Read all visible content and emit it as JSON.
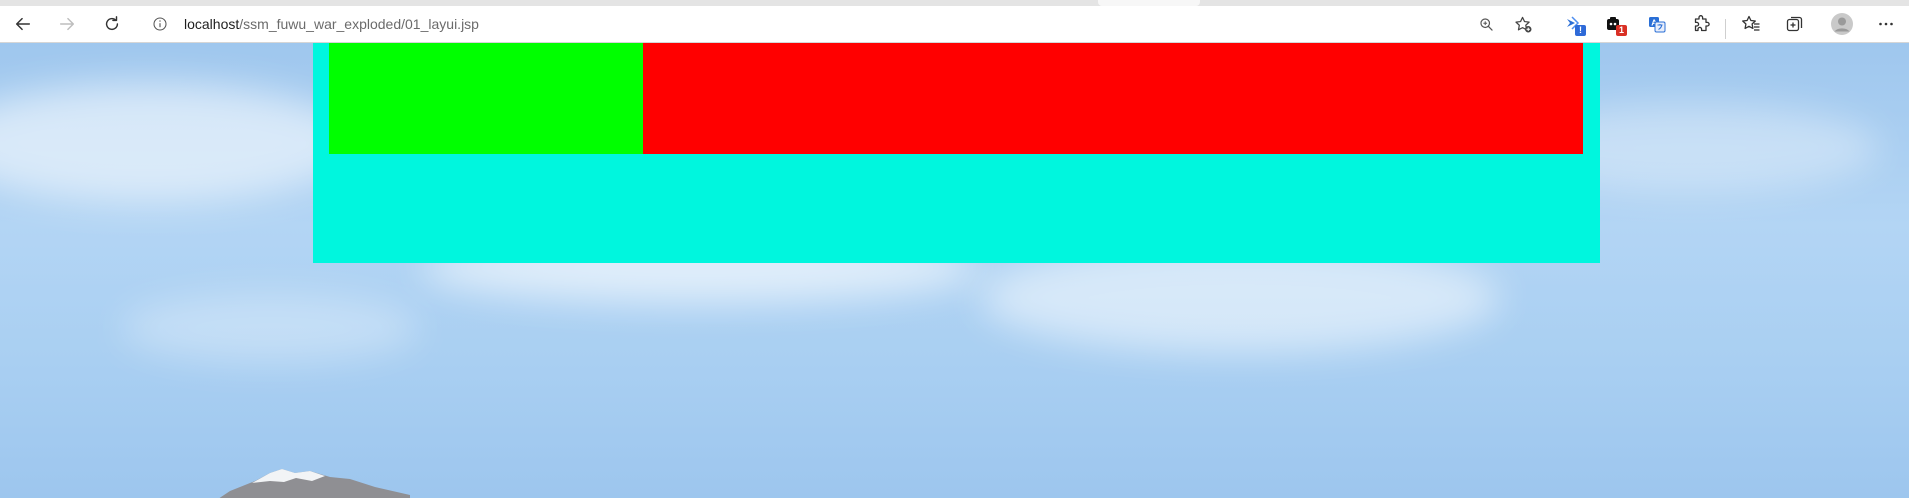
{
  "browser": {
    "address_bar": {
      "host": "localhost",
      "path": "/ssm_fuwu_war_exploded/01_layui.jsp"
    },
    "toolbar_icons": [
      "back-arrow-icon",
      "forward-arrow-icon",
      "refresh-icon",
      "site-info-icon",
      "zoom-icon",
      "add-favorite-icon",
      "extension-1-icon",
      "extension-2-icon",
      "translate-icon",
      "extensions-puzzle-icon",
      "favorites-icon",
      "collections-icon",
      "profile-avatar-icon",
      "more-menu-icon"
    ],
    "extension_badges": {
      "ext1": "!",
      "ext2": "1"
    }
  },
  "page": {
    "colors": {
      "outer_block": "#00f6de",
      "green_block": "#00ff00",
      "red_block": "#ff0000"
    }
  }
}
